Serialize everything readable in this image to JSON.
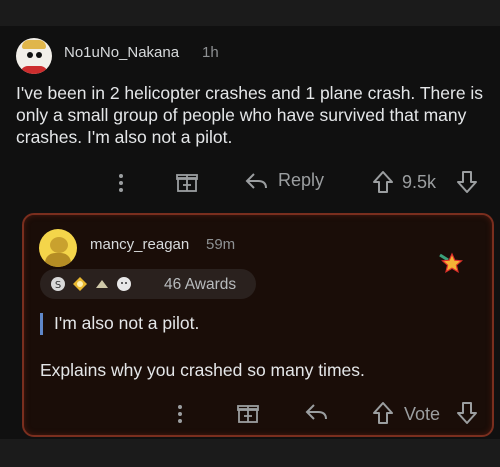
{
  "comment": {
    "username": "No1uNo_Nakana",
    "time": "1h",
    "body": "I've been in 2 helicopter crashes and 1 plane crash. There is only a small group of people who have survived that many crashes. I'm also not a pilot.",
    "reply_label": "Reply",
    "vote_count": "9.5k"
  },
  "reply": {
    "username": "mancy_reagan",
    "time": "59m",
    "awards_count": "46 Awards",
    "quote": "I'm also not a pilot.",
    "body": "Explains why you crashed so many times.",
    "vote_label": "Vote"
  },
  "colors": {
    "background": "#101010",
    "reply_border": "#7a2e1e",
    "quote_bar": "#5f87c9"
  }
}
